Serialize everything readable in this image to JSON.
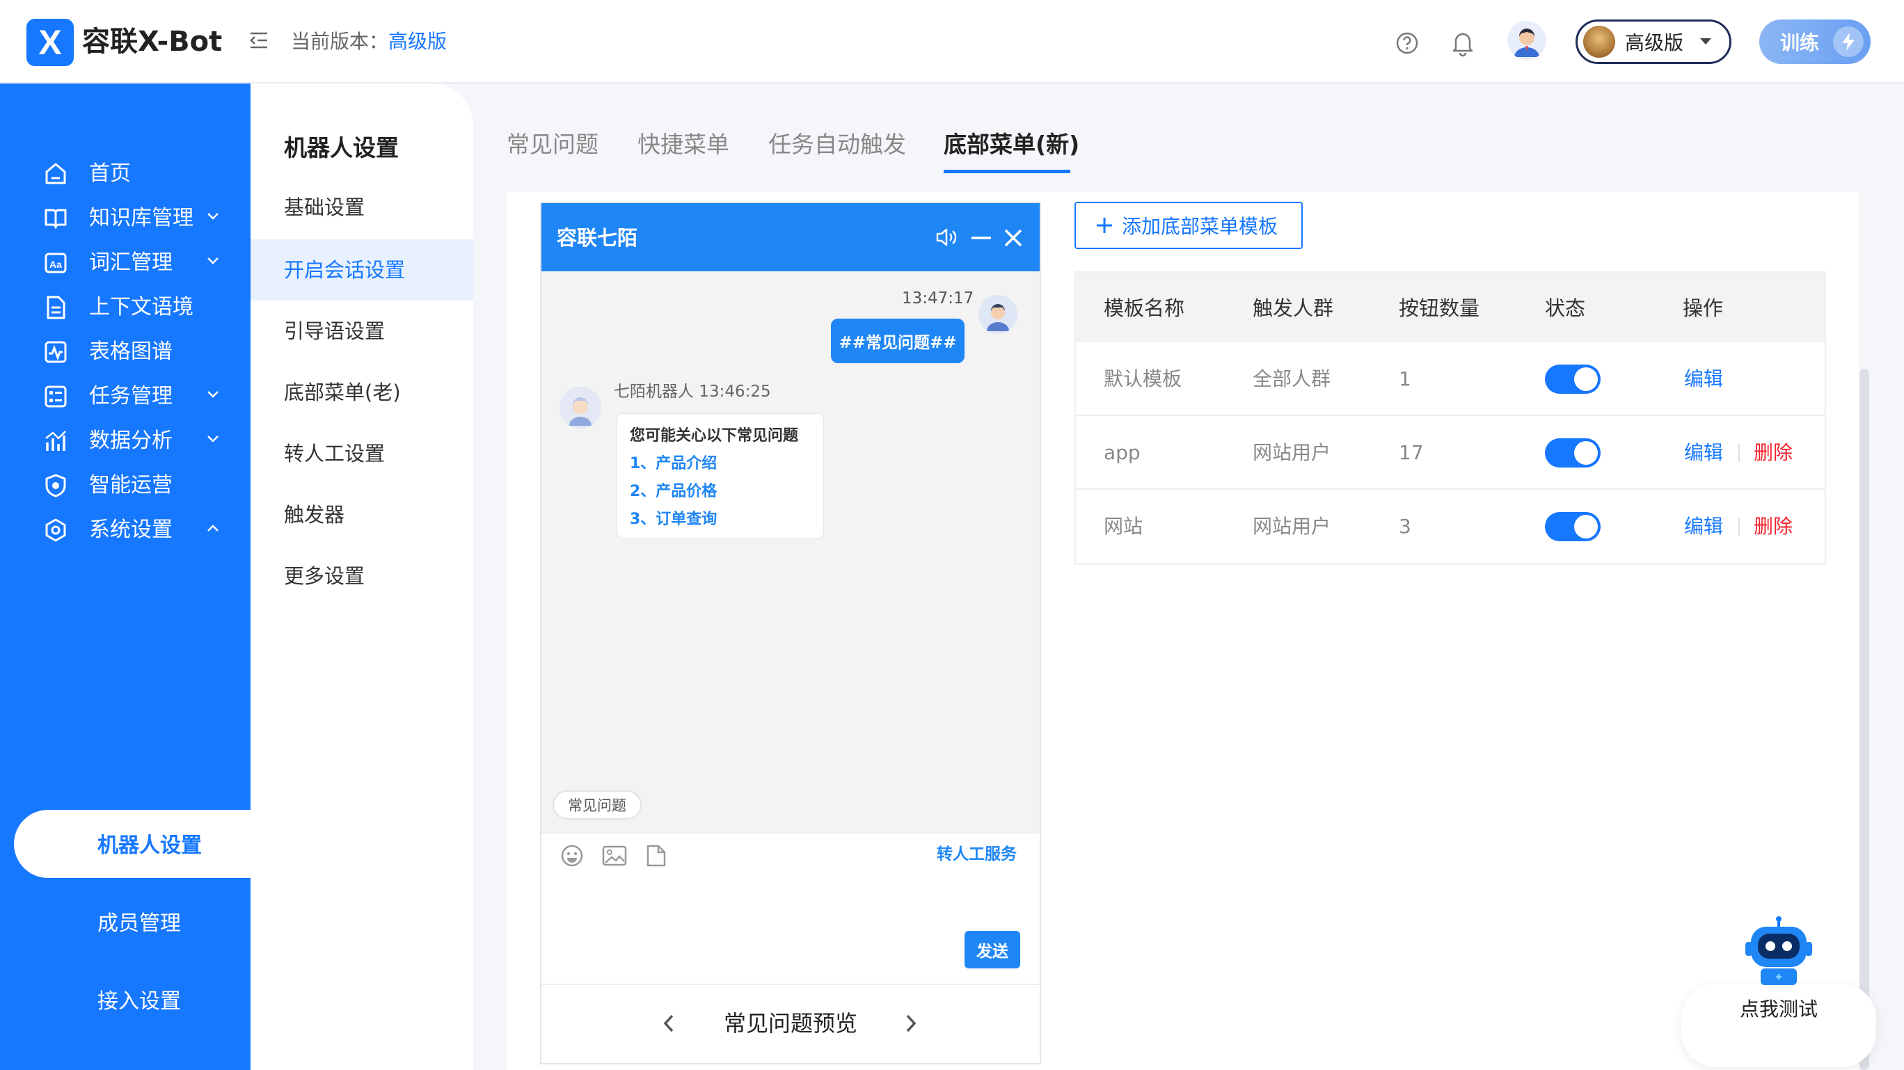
{
  "header": {
    "logo_mark": "X",
    "app_name": "容联X-Bot",
    "version_label": "当前版本：",
    "version_value": "高级版",
    "plan_label": "高级版",
    "train_label": "训练"
  },
  "sidebar": {
    "items": [
      {
        "label": "首页",
        "icon": "home-icon"
      },
      {
        "label": "知识库管理",
        "icon": "book-icon"
      },
      {
        "label": "词汇管理",
        "icon": "vocabulary-icon"
      },
      {
        "label": "上下文语境",
        "icon": "document-icon"
      },
      {
        "label": "表格图谱",
        "icon": "chart-icon"
      },
      {
        "label": "任务管理",
        "icon": "task-icon"
      },
      {
        "label": "数据分析",
        "icon": "analytics-icon"
      },
      {
        "label": "智能运营",
        "icon": "shield-icon"
      },
      {
        "label": "系统设置",
        "icon": "settings-icon"
      }
    ],
    "sub_items": [
      {
        "label": "机器人设置",
        "active": true
      },
      {
        "label": "成员管理"
      },
      {
        "label": "接入设置"
      }
    ]
  },
  "settings_menu": {
    "title": "机器人设置",
    "items": [
      {
        "label": "基础设置"
      },
      {
        "label": "开启会话设置",
        "active": true
      },
      {
        "label": "引导语设置"
      },
      {
        "label": "底部菜单(老)"
      },
      {
        "label": "转人工设置"
      },
      {
        "label": "触发器"
      },
      {
        "label": "更多设置"
      }
    ]
  },
  "tabs": [
    {
      "label": "常见问题"
    },
    {
      "label": "快捷菜单"
    },
    {
      "label": "任务自动触发"
    },
    {
      "label": "底部菜单(新)",
      "active": true
    }
  ],
  "chat_preview": {
    "title": "容联七陌",
    "user_time": "13:47:17",
    "user_message": "##常见问题##",
    "bot_name_time": "七陌机器人 13:46:25",
    "bot_intro": "您可能关心以下常见问题",
    "bot_links": [
      "1、产品介绍",
      "2、产品价格",
      "3、订单查询"
    ],
    "quick_tag": "常见问题",
    "transfer_label": "转人工服务",
    "send_label": "发送",
    "footer_title": "常见问题预览"
  },
  "template_panel": {
    "add_button": "添加底部菜单模板",
    "columns": [
      "模板名称",
      "触发人群",
      "按钮数量",
      "状态",
      "操作"
    ],
    "rows": [
      {
        "name": "默认模板",
        "audience": "全部人群",
        "count": "1",
        "enabled": true,
        "edit": "编辑",
        "delete": ""
      },
      {
        "name": "app",
        "audience": "网站用户",
        "count": "17",
        "enabled": true,
        "edit": "编辑",
        "delete": "删除"
      },
      {
        "name": "网站",
        "audience": "网站用户",
        "count": "3",
        "enabled": true,
        "edit": "编辑",
        "delete": "删除"
      }
    ]
  },
  "test_widget": {
    "label": "点我测试"
  },
  "colors": {
    "primary": "#1677ff",
    "danger": "#f5222d",
    "chat_header": "#1f86f5"
  }
}
